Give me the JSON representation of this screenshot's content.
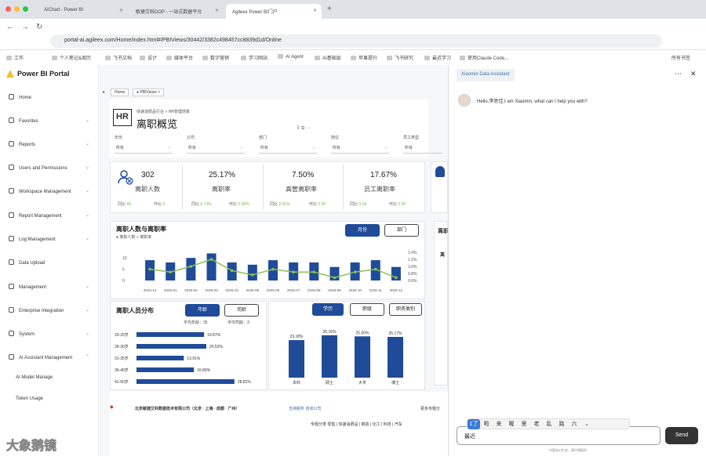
{
  "browser": {
    "tabs": [
      "AIChart - Power BI",
      "敏捷艾科DOP - 一站式数据平台",
      "Agileex Power BI门户"
    ],
    "url": "portal-ai.agileex.com/Home/index.html#/PBIViews/30442/3382c498457cc8839d1d/Online",
    "bookmarks": [
      "工作",
      "个人笔记&周历",
      "飞书文档",
      "设计",
      "媒体平台",
      "数字营销",
      "学习网站",
      "AI Agent",
      "AI基础层",
      "苹果提升",
      "飞书研究",
      "最近学习",
      "使用Claude Code...",
      "所有书签"
    ]
  },
  "sidebar": {
    "title": "Power BI Portal",
    "items": [
      "Home",
      "Favorites",
      "Reports",
      "Users and Permissions",
      "Workspace Management",
      "Report Management",
      "Log Management",
      "Data Upload",
      "Management",
      "Enterprise Integration",
      "System",
      "AI Assistant Management",
      "AI Model Manage",
      "Token Usage"
    ]
  },
  "breadcrumb": [
    "Home",
    "PBIViews"
  ],
  "report": {
    "logo": "HR",
    "subtitle": "快速消费品行业 > HR管理场景",
    "title": "离职概览",
    "filters": [
      {
        "label": "年份",
        "value": "所有"
      },
      {
        "label": "公司",
        "value": "所有"
      },
      {
        "label": "部门",
        "value": "所有"
      },
      {
        "label": "岗位",
        "value": "所有"
      },
      {
        "label": "员工类型",
        "value": "所有"
      }
    ],
    "kpis": [
      {
        "value": "302",
        "label": "离职人数",
        "yoy_label": "同比",
        "yoy": "99",
        "mom_label": "环比",
        "mom": "6"
      },
      {
        "value": "25.17%",
        "label": "离职率",
        "yoy_label": "同比",
        "yoy": "6.73%",
        "mom_label": "环比",
        "mom": "0.38%"
      },
      {
        "value": "7.50%",
        "label": "高管离职率",
        "yoy_label": "同比",
        "yoy": "2.61%",
        "mom_label": "环比",
        "mom": "0.00"
      },
      {
        "value": "17.67%",
        "label": "员工离职率",
        "yoy_label": "同比",
        "yoy": "0.04",
        "mom_label": "环比",
        "mom": "0.00"
      }
    ],
    "trend": {
      "title": "离职人数与离职率",
      "legend": [
        "离职人数",
        "离职率"
      ],
      "buttons": [
        "月份",
        "部门"
      ]
    },
    "dist": {
      "title": "离职人员分布",
      "buttons": [
        "年龄",
        "司龄"
      ],
      "avg_age": "平均年龄：35",
      "avg_tenure": "平均司龄：3"
    },
    "edu_buttons": [
      "学历",
      "职级",
      "职务类别"
    ],
    "right_cut_title": "离职",
    "right_cut_label": "离"
  },
  "chart_data": [
    {
      "type": "bar",
      "title": "离职人数与离职率",
      "categories": [
        "2024-12",
        "2025-01",
        "2025-02",
        "2025-03",
        "2025-04",
        "2025-05",
        "2025-06",
        "2025-07",
        "2025-08",
        "2025-09",
        "2025-10",
        "2025-11",
        "2025-12"
      ],
      "series": [
        {
          "name": "离职人数",
          "values": [
            9,
            8,
            10,
            12,
            8,
            7,
            9,
            8,
            8,
            6,
            8,
            9,
            6
          ]
        },
        {
          "name": "离职率",
          "values": [
            0.9,
            0.8,
            1.0,
            1.25,
            0.85,
            0.7,
            0.9,
            0.8,
            0.8,
            0.6,
            0.8,
            0.9,
            0.6
          ]
        }
      ],
      "yticks": [
        "0",
        "5",
        "10"
      ],
      "y2ticks": [
        "0.6%",
        "0.8%",
        "1.0%",
        "1.2%",
        "1.4%"
      ]
    },
    {
      "type": "bar",
      "orientation": "horizontal",
      "categories": [
        "20-25岁",
        "26-30岁",
        "31-35岁",
        "36-40岁",
        "41-50岁"
      ],
      "values": [
        19.87,
        20.53,
        13.91,
        16.89,
        28.81
      ],
      "labels": [
        "19.87%",
        "20.53%",
        "13.91%",
        "16.89%",
        "28.81%"
      ]
    },
    {
      "type": "bar",
      "categories": [
        "本科",
        "硕士",
        "大专",
        "博士"
      ],
      "values": [
        23.18,
        26.16,
        25.5,
        25.17
      ],
      "labels": [
        "23.18%",
        "26.16%",
        "25.50%",
        "25.17%"
      ]
    }
  ],
  "footer": {
    "company": "北京敏捷艾科数据技术有限公司（北京 · 上海 · 成都 · 广州）",
    "links": "支持服务 咨询公司",
    "more": "更多专题分",
    "cats": "专题分类  零售 | 快速消费品 | 制造 | 化工 | 科技 | 汽车"
  },
  "assistant": {
    "tab": "Xiaomin Data Assistant",
    "greeting": "Hello,李思佳,I am Xiaomin, what can I help you with?",
    "input": "最近",
    "send": "Send",
    "hint": "内容由AI生成，请仔细甄别",
    "ime": [
      "1了",
      "啦",
      "来",
      "喔",
      "里",
      "老",
      "乱",
      "路",
      "六"
    ]
  },
  "watermark": "大象鹅镜",
  "colors": {
    "navy": "#1f4b99",
    "line": "#8cc152"
  }
}
